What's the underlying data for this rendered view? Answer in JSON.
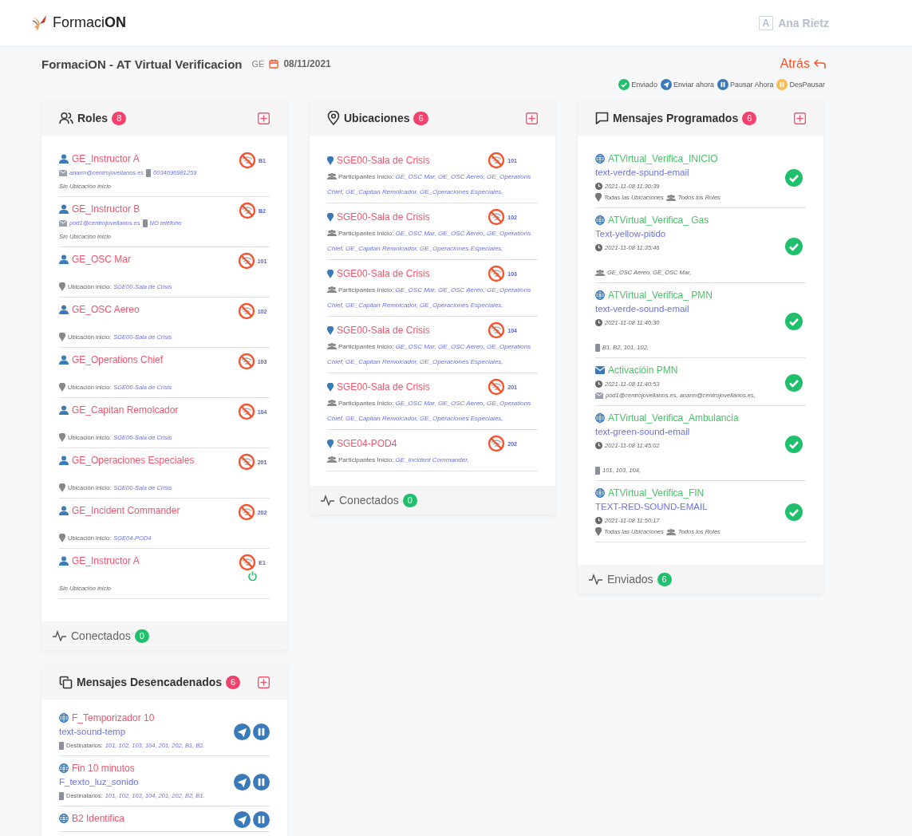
{
  "navbar": {
    "brand": "Formaci**ON**",
    "avatar": "A",
    "user": "Ana Rietz"
  },
  "header": {
    "title": "FormaciON - AT Virtual Verificacion",
    "tag": "GE",
    "date": "08/11/2021",
    "back": "Atrás"
  },
  "legend": [
    {
      "kind": "sent",
      "label": "Enviado"
    },
    {
      "kind": "send",
      "label": "Enviar ahora"
    },
    {
      "kind": "pause",
      "label": "Pausar Ahora"
    },
    {
      "kind": "resume",
      "label": "DesPausar"
    }
  ],
  "roles": {
    "title": "Roles",
    "count": "8",
    "footer": {
      "label": "Conectados",
      "count": "0"
    },
    "items": [
      {
        "name": "GE_Instructor A",
        "code": "B1",
        "email": "anarm@centrojovellanos.es",
        "phone": "0034696981259",
        "no_location": "Sin Ubicación inicio",
        "power": false
      },
      {
        "name": "GE_Instructor B",
        "code": "B2",
        "email": "pod1@centrojovellanos.es",
        "phone": "NO teléfono",
        "no_location": "Sin Ubicación inicio",
        "power": false
      },
      {
        "name": "GE_OSC Mar",
        "code": "101",
        "location_label": "Ubicación inicio:",
        "location": "SGE00-Sala de Crisis",
        "power": false
      },
      {
        "name": "GE_OSC Aereo",
        "code": "102",
        "location_label": "Ubicación inicio:",
        "location": "SGE00-Sala de Crisis",
        "power": false
      },
      {
        "name": "GE_Operations Chief",
        "code": "103",
        "location_label": "Ubicación inicio:",
        "location": "SGE00-Sala de Crisis",
        "power": false
      },
      {
        "name": "GE_Capitan Remolcador",
        "code": "104",
        "location_label": "Ubicación inicio:",
        "location": "SGE00-Sala de Crisis",
        "power": false
      },
      {
        "name": "GE_Operaciones Especiales",
        "code": "201",
        "location_label": "Ubicación inicio:",
        "location": "SGE00-Sala de Crisis",
        "power": false
      },
      {
        "name": "GE_Incident Commander",
        "code": "202",
        "location_label": "Ubicación inicio:",
        "location": "SGE04-POD4",
        "power": false
      },
      {
        "name": "GE_Instructor A",
        "code": "E1",
        "no_location": "Sin Ubicación inicio",
        "power": true
      }
    ]
  },
  "locations": {
    "title": "Ubicaciones",
    "count": "6",
    "footer": {
      "label": "Conectados",
      "count": "0"
    },
    "items": [
      {
        "name": "SGE00-Sala de Crisis",
        "code": "101",
        "participants_label": "Participantes Inicio:",
        "participants": "GE_OSC Mar, GE_OSC Aereo, GE_Operations Chief, GE_Capitan Remolcador, GE_Operaciones Especiales,"
      },
      {
        "name": "SGE00-Sala de Crisis",
        "code": "102",
        "participants_label": "Participantes Inicio:",
        "participants": "GE_OSC Mar, GE_OSC Aereo, GE_Operations Chief, GE_Capitan Remolcador, GE_Operaciones Especiales,"
      },
      {
        "name": "SGE00-Sala de Crisis",
        "code": "103",
        "participants_label": "Participantes Inicio:",
        "participants": "GE_OSC Mar, GE_OSC Aereo, GE_Operations Chief, GE_Capitan Remolcador, GE_Operaciones Especiales,"
      },
      {
        "name": "SGE00-Sala de Crisis",
        "code": "104",
        "participants_label": "Participantes Inicio:",
        "participants": "GE_OSC Mar, GE_OSC Aereo, GE_Operations Chief, GE_Capitan Remolcador, GE_Operaciones Especiales,"
      },
      {
        "name": "SGE00-Sala de Crisis",
        "code": "201",
        "participants_label": "Participantes Inicio:",
        "participants": "GE_OSC Mar, GE_OSC Aereo, GE_Operations Chief, GE_Capitan Remolcador, GE_Operaciones Especiales,"
      },
      {
        "name": "SGE04-POD4",
        "code": "202",
        "participants_label": "Participantes Inicio:",
        "participants": "GE_Incident Commander,"
      }
    ]
  },
  "scheduled": {
    "title": "Mensajes Programados",
    "count": "6",
    "footer": {
      "label": "Enviados",
      "count": "6"
    },
    "items": [
      {
        "kind": "web",
        "title": "ATVirtual_Verifica_INICIO",
        "text": "text-verde-spund-email",
        "time": "2021-11-08 11:30:39",
        "sent": true,
        "targets": [
          {
            "kind": "location",
            "text": "Todas las Ubicaciones"
          },
          {
            "kind": "roles",
            "text": "Todos los Roles"
          }
        ]
      },
      {
        "kind": "web",
        "title": "ATVirtual_Verifica_ Gas",
        "text": "Text-yellow-pitido",
        "time": "2021-11-08 11:35:46",
        "sent": true,
        "targets": [
          {
            "kind": "roles",
            "text": "GE_OSC Aereo, GE_OSC Mar,"
          }
        ]
      },
      {
        "kind": "web",
        "title": "ATVirtual_Verifica_ PMN",
        "text": "text-verde-sound-email",
        "time": "2021-11-08 11:40:30",
        "sent": true,
        "targets": [
          {
            "kind": "device",
            "text": "B1, B2, 101, 102,"
          }
        ]
      },
      {
        "kind": "email",
        "title": "Activacióin PMN",
        "time": "2021-11-08 11:40:53",
        "sent": true,
        "targets": [
          {
            "kind": "email",
            "text": "pod1@centrojovellanos.es, anarm@centrojovellanos.es,"
          }
        ]
      },
      {
        "kind": "web",
        "title": "ATVirtual_Verifica_Ambulancia",
        "text": "text-green-sound-email",
        "time": "2021-11-08 11:45:02",
        "sent": true,
        "targets": [
          {
            "kind": "device",
            "text": "101, 103, 104,"
          }
        ]
      },
      {
        "kind": "web",
        "title": "ATVirtual_Verifica_FIN",
        "text": "TEXT-RED-SOUND-EMAIL",
        "time": "2021-11-08 11:50:17",
        "sent": true,
        "targets": [
          {
            "kind": "location",
            "text": "Todas las Ubicaciones"
          },
          {
            "kind": "roles",
            "text": "Todos los Roles"
          }
        ]
      }
    ]
  },
  "triggered": {
    "title": "Mensajes Desencadenados",
    "count": "6",
    "items": [
      {
        "title": "F_Temporizador 10",
        "text": "text-sound-temp",
        "recipients_label": "Destinatarios:",
        "recipients": "101, 102, 103, 104, 201, 202, B1, B2."
      },
      {
        "title": "Fin 10 minutos",
        "text": "F_texto_luz_sonido",
        "recipients_label": "Destinatarios:",
        "recipients": "101, 102, 103, 104, 201, 202, B2, B1."
      },
      {
        "title": "B2 Identifica"
      }
    ]
  }
}
